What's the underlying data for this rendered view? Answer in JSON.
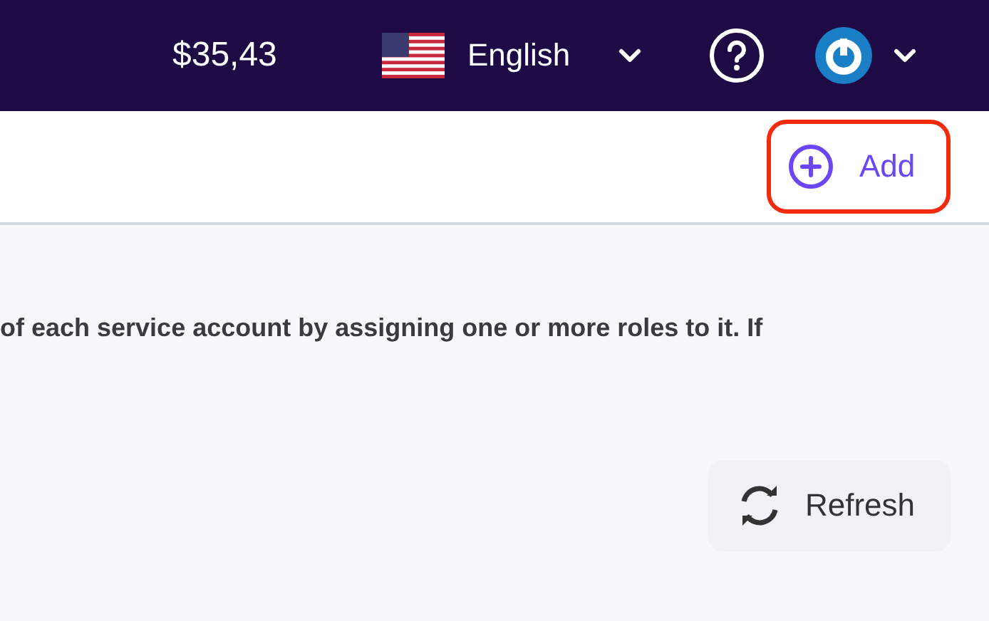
{
  "top_bar": {
    "balance": "$35,43",
    "language": {
      "label": "English",
      "expanded": false
    },
    "help": true,
    "account": {
      "expanded": false
    }
  },
  "toolbar": {
    "add_button": {
      "label": "Add",
      "highlighted": true
    }
  },
  "content": {
    "description": "of each service account by assigning one or more roles to it. If",
    "refresh_button": {
      "label": "Refresh"
    }
  }
}
